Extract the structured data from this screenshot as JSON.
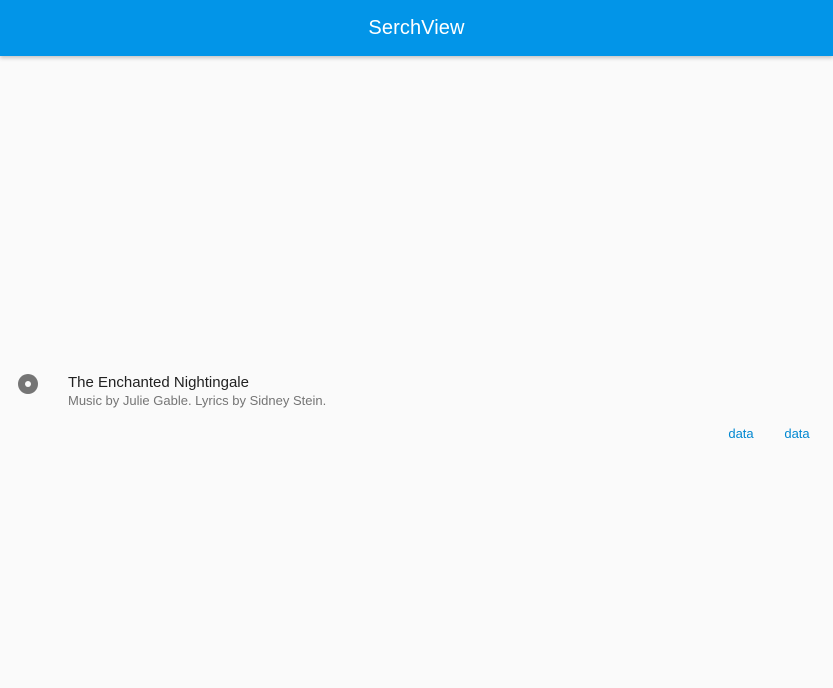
{
  "app_bar": {
    "title": "SerchView",
    "color": "#0295e8"
  },
  "list_tile": {
    "icon": "album-icon",
    "title": "The Enchanted Nightingale",
    "subtitle": "Music by Julie Gable. Lyrics by Sidney Stein."
  },
  "actions": [
    {
      "label": "data"
    },
    {
      "label": "data"
    }
  ]
}
